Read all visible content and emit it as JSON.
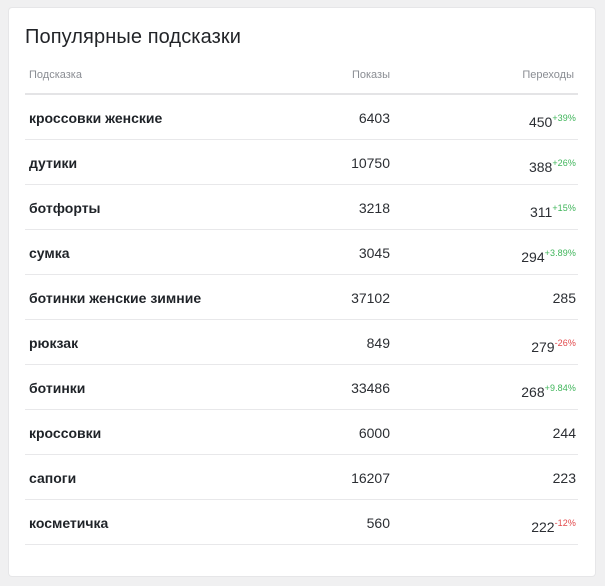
{
  "card": {
    "title": "Популярные подсказки"
  },
  "table": {
    "columns": {
      "name": "Подсказка",
      "shows": "Показы",
      "clicks": "Переходы"
    },
    "rows": [
      {
        "name": "кроссовки женские",
        "shows": "6403",
        "clicks": "450",
        "delta": "+39%",
        "trend": "up"
      },
      {
        "name": "дутики",
        "shows": "10750",
        "clicks": "388",
        "delta": "+26%",
        "trend": "up"
      },
      {
        "name": "ботфорты",
        "shows": "3218",
        "clicks": "311",
        "delta": "+15%",
        "trend": "up"
      },
      {
        "name": "сумка",
        "shows": "3045",
        "clicks": "294",
        "delta": "+3.89%",
        "trend": "up"
      },
      {
        "name": "ботинки женские зимние",
        "shows": "37102",
        "clicks": "285",
        "delta": "",
        "trend": "none"
      },
      {
        "name": "рюкзак",
        "shows": "849",
        "clicks": "279",
        "delta": "-26%",
        "trend": "down"
      },
      {
        "name": "ботинки",
        "shows": "33486",
        "clicks": "268",
        "delta": "+9.84%",
        "trend": "up"
      },
      {
        "name": "кроссовки",
        "shows": "6000",
        "clicks": "244",
        "delta": "",
        "trend": "none"
      },
      {
        "name": "сапоги",
        "shows": "16207",
        "clicks": "223",
        "delta": "",
        "trend": "none"
      },
      {
        "name": "косметичка",
        "shows": "560",
        "clicks": "222",
        "delta": "-12%",
        "trend": "down"
      }
    ]
  },
  "colors": {
    "positive": "#3fb55a",
    "negative": "#e2494b"
  }
}
